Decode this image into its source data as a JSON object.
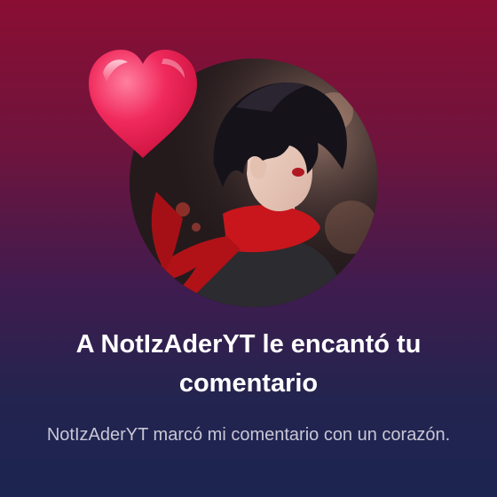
{
  "notification": {
    "title": "A NotIzAderYT le encantó tu comentario",
    "body": "NotIzAderYT marcó mi comentario con un corazón."
  },
  "avatar": {
    "icon": "anime-avatar-image"
  },
  "reaction": {
    "icon": "heart-icon",
    "color": "#e8184e"
  },
  "colors": {
    "background_top": "#8a0e33",
    "background_bottom": "#1c2450",
    "title_text": "#ffffff",
    "body_text": "#c9c6d6"
  }
}
